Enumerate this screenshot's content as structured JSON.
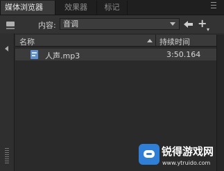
{
  "tabs": [
    {
      "label": "媒体浏览器",
      "active": true,
      "close": "×"
    },
    {
      "label": "效果器",
      "active": false
    },
    {
      "label": "标记",
      "active": false
    }
  ],
  "panel_menu_icon": "panel-menu-icon",
  "toolbar": {
    "content_label": "内容:",
    "content_value": "音调",
    "icons": [
      "monitor-icon",
      "back-arrow-icon",
      "add-icon"
    ]
  },
  "list": {
    "columns": {
      "name": "名称",
      "duration": "持续时间"
    },
    "rows": [
      {
        "name": "人声.mp3",
        "duration": "3:50.164",
        "icon": "audio-file-icon"
      }
    ]
  },
  "watermark": {
    "title": "锐得游戏网",
    "url": "www.ytruido.com"
  },
  "colors": {
    "background": "#2b2b2b",
    "tab_active": "#3a3a3a",
    "row_selected": "#3b3b3b",
    "file_icon": "#5e8fd0",
    "watermark_logo": "#2f7fd6"
  }
}
